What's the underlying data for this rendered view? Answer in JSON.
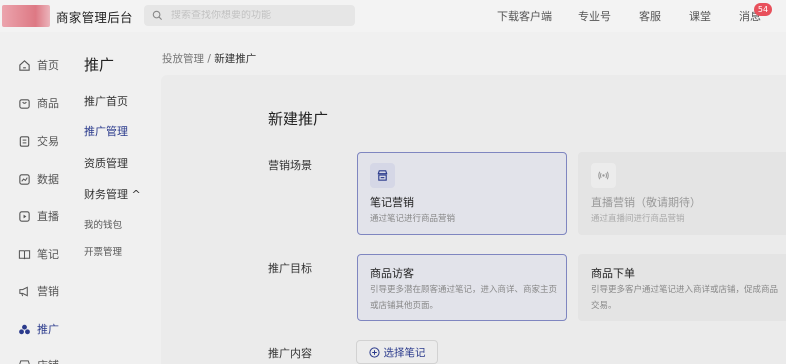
{
  "header": {
    "app_title": "商家管理后台",
    "search_placeholder": "搜索查找你想要的功能",
    "nav": [
      "下载客户端",
      "专业号",
      "客服",
      "课堂",
      "消息"
    ],
    "message_badge": "54"
  },
  "rail": {
    "items": [
      {
        "label": "首页",
        "icon": "home-icon"
      },
      {
        "label": "商品",
        "icon": "bag-icon"
      },
      {
        "label": "交易",
        "icon": "receipt-icon"
      },
      {
        "label": "数据",
        "icon": "chart-icon"
      },
      {
        "label": "直播",
        "icon": "play-icon"
      },
      {
        "label": "笔记",
        "icon": "book-icon"
      },
      {
        "label": "营销",
        "icon": "megaphone-icon"
      },
      {
        "label": "推广",
        "icon": "users-icon",
        "active": true
      },
      {
        "label": "店铺",
        "icon": "store-icon"
      }
    ]
  },
  "submenu": {
    "title": "推广",
    "items": [
      "推广首页",
      "推广管理",
      "资质管理",
      "财务管理 ^",
      "我的钱包",
      "开票管理"
    ]
  },
  "breadcrumb": {
    "parent": "投放管理",
    "separator": "/",
    "current": "新建推广"
  },
  "form": {
    "heading": "新建推广",
    "scene_label": "营销场景",
    "scene_options": [
      {
        "title": "笔记营销",
        "desc": "通过笔记进行商品营销",
        "selected": true,
        "icon": "store-icon"
      },
      {
        "title": "直播营销（敬请期待）",
        "desc": "通过直播间进行商品营销",
        "selected": false,
        "icon": "broadcast-icon"
      }
    ],
    "goal_label": "推广目标",
    "goal_options": [
      {
        "title": "商品访客",
        "desc": "引导更多潜在顾客通过笔记，进入商详、商家主页或店铺其他页面。",
        "selected": true
      },
      {
        "title": "商品下单",
        "desc": "引导更多客户通过笔记进入商详或店铺，促成商品交易。",
        "selected": false
      }
    ],
    "content_label": "推广内容",
    "choose_button": "选择笔记"
  },
  "colors": {
    "accent": "#2a3a8c",
    "selected_border": "#7f86c0",
    "badge": "#e8505b"
  }
}
